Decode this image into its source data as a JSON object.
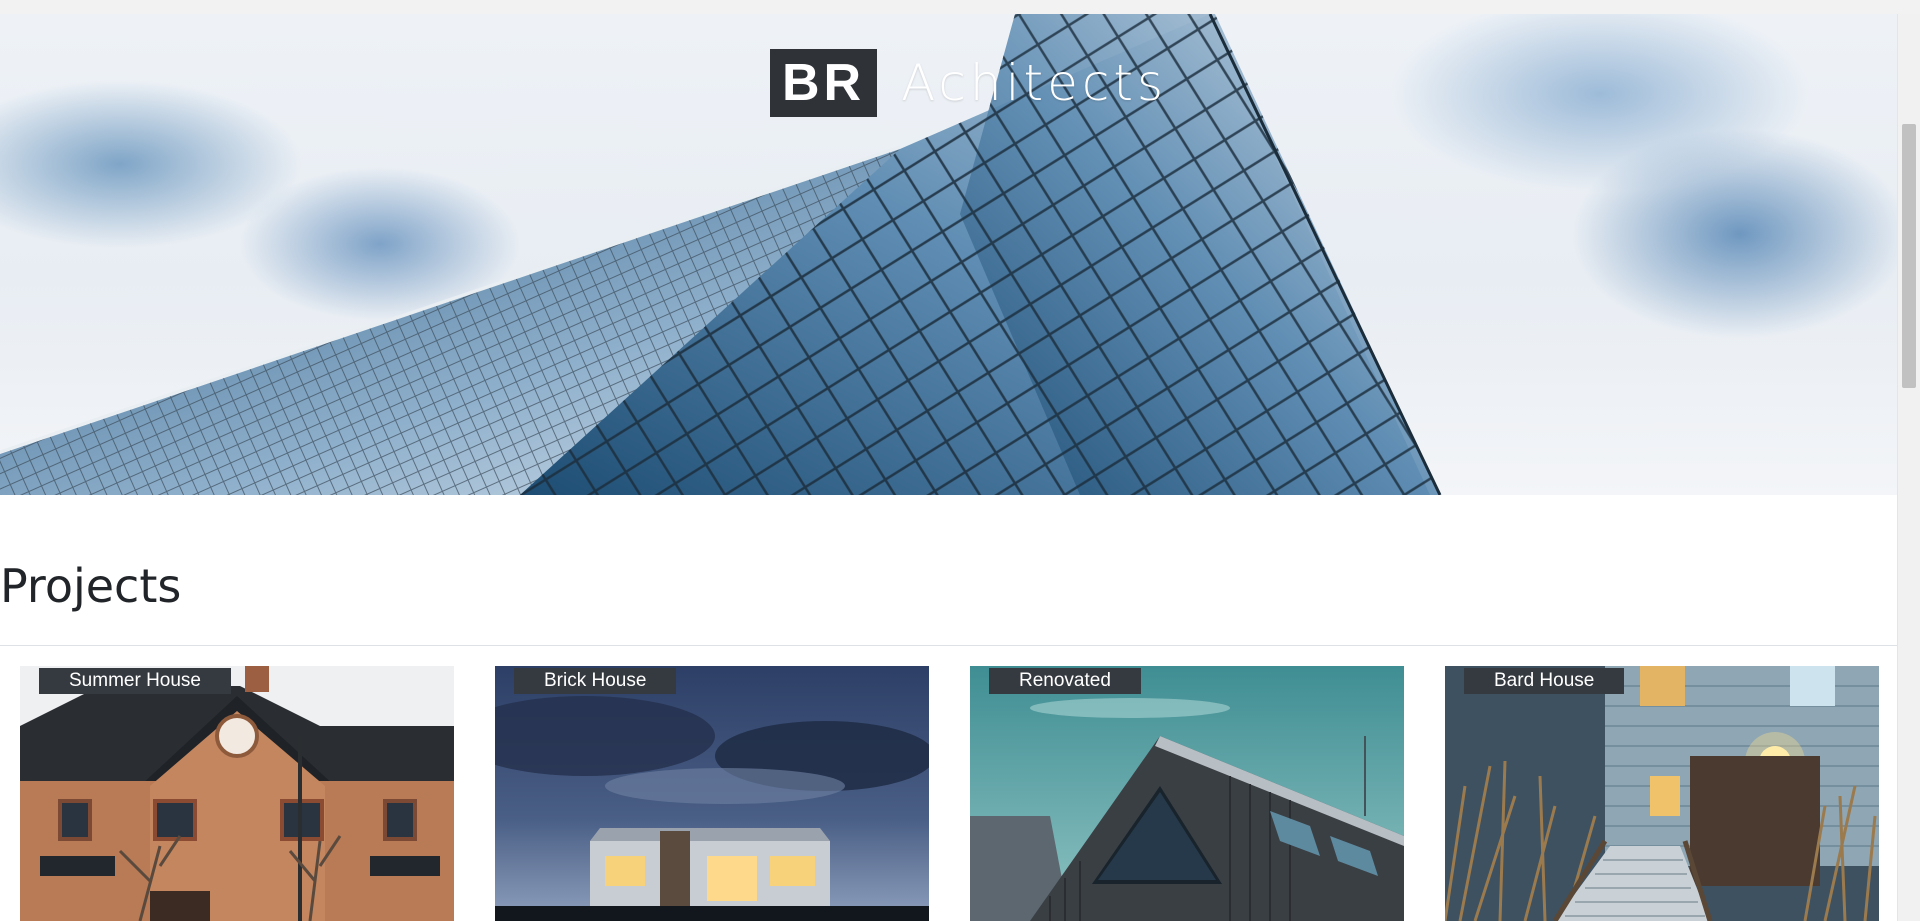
{
  "brand": {
    "mark": "BR",
    "name": "Achitects"
  },
  "projects": {
    "heading": "Projects",
    "items": [
      {
        "label": "Summer House"
      },
      {
        "label": "Brick House"
      },
      {
        "label": "Renovated"
      },
      {
        "label": "Bard House"
      }
    ]
  },
  "colors": {
    "label_bg": "#353a40",
    "logo_bg": "#2f3237",
    "heading": "#212529",
    "divider": "#dee2e6"
  }
}
